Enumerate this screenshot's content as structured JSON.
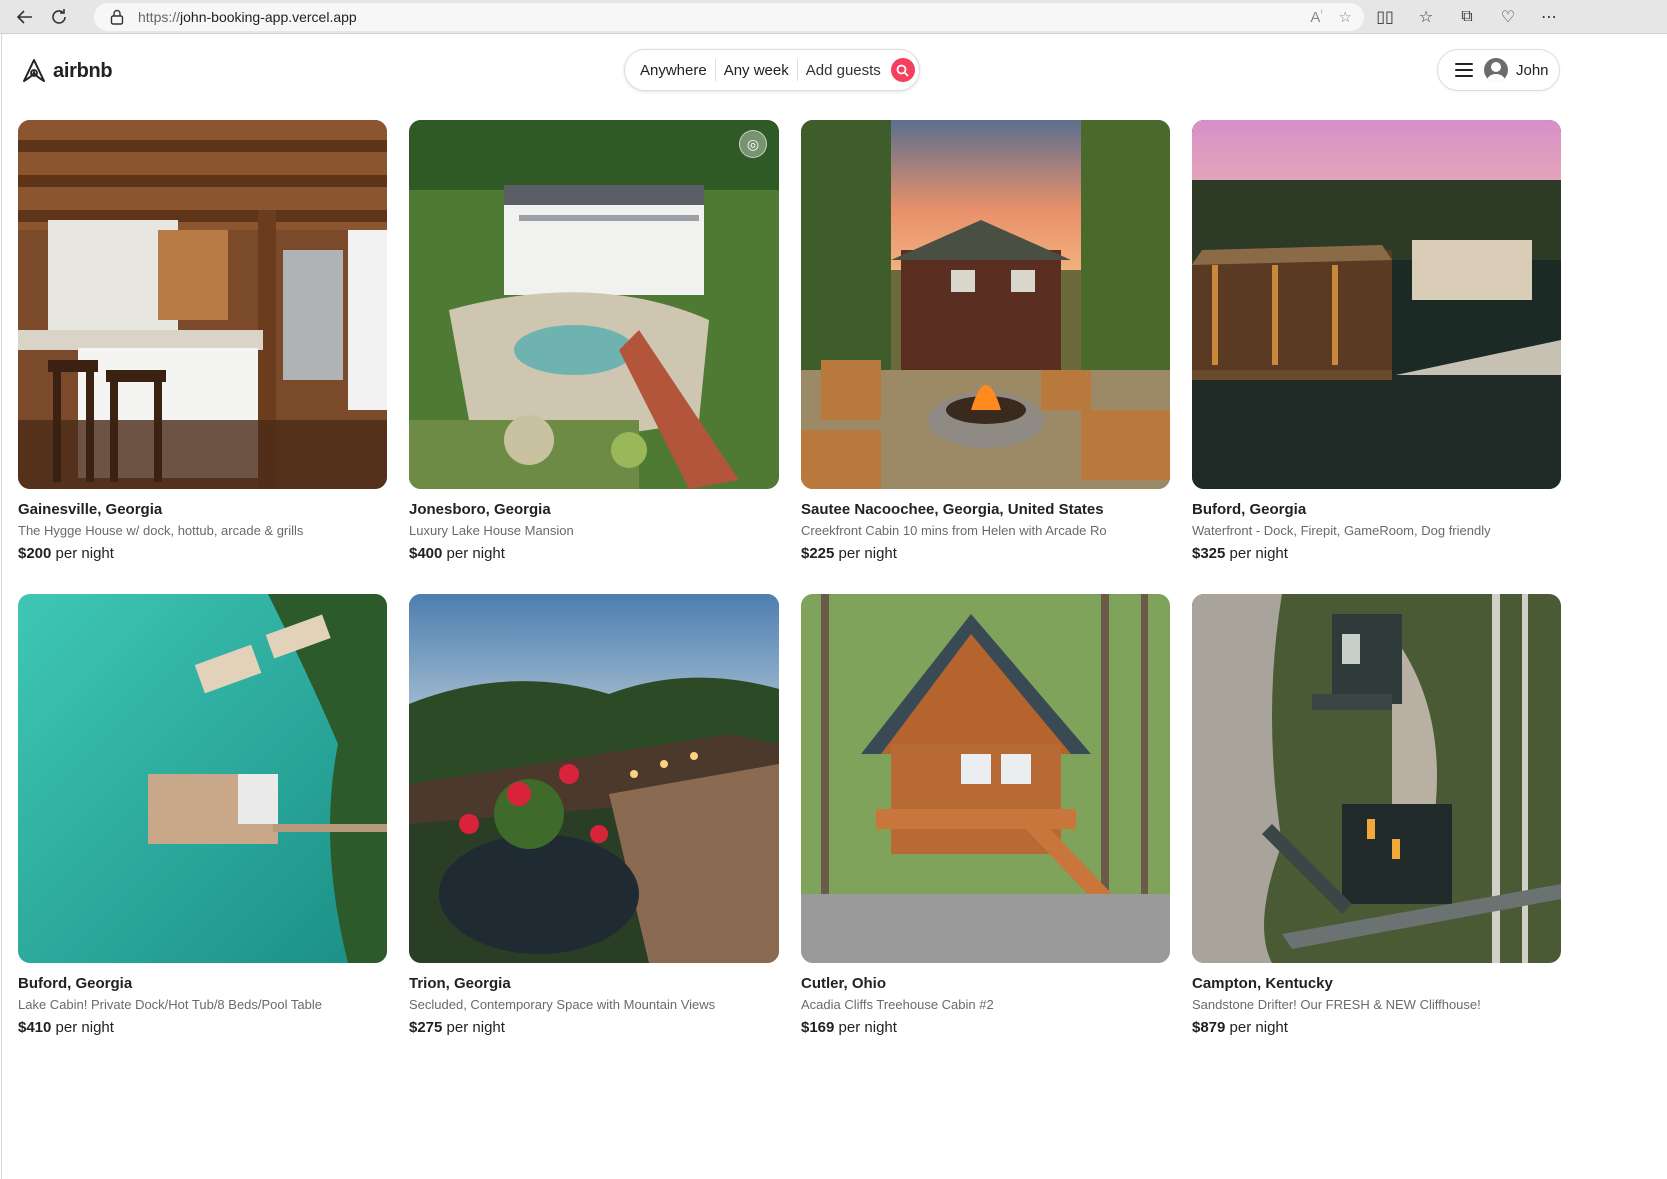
{
  "browser": {
    "url_scheme": "https://",
    "url_host": "john-booking-app.vercel.app"
  },
  "header": {
    "brand": "airbnb",
    "search": {
      "location": "Anywhere",
      "week": "Any week",
      "guests": "Add guests"
    },
    "user_name": "John"
  },
  "price_suffix": "per night",
  "listings": [
    {
      "location": "Gainesville, Georgia",
      "description": "The Hygge House w/ dock, hottub, arcade & grills",
      "price": "$200"
    },
    {
      "location": "Jonesboro, Georgia",
      "description": "Luxury Lake House Mansion",
      "price": "$400"
    },
    {
      "location": "Sautee Nacoochee, Georgia, United States",
      "description": "Creekfront Cabin 10 mins from Helen with Arcade Ro",
      "price": "$225"
    },
    {
      "location": "Buford, Georgia",
      "description": "Waterfront - Dock, Firepit, GameRoom, Dog friendly",
      "price": "$325"
    },
    {
      "location": "Buford, Georgia",
      "description": "Lake Cabin! Private Dock/Hot Tub/8 Beds/Pool Table",
      "price": "$410"
    },
    {
      "location": "Trion, Georgia",
      "description": "Secluded, Contemporary Space with Mountain Views",
      "price": "$275"
    },
    {
      "location": "Cutler, Ohio",
      "description": "Acadia Cliffs Treehouse Cabin #2",
      "price": "$169"
    },
    {
      "location": "Campton, Kentucky",
      "description": "Sandstone Drifter! Our FRESH & NEW Cliffhouse!",
      "price": "$879"
    }
  ],
  "colors": {
    "accent": "#f43f5e",
    "text": "#222222",
    "muted": "#6a6a6a"
  }
}
